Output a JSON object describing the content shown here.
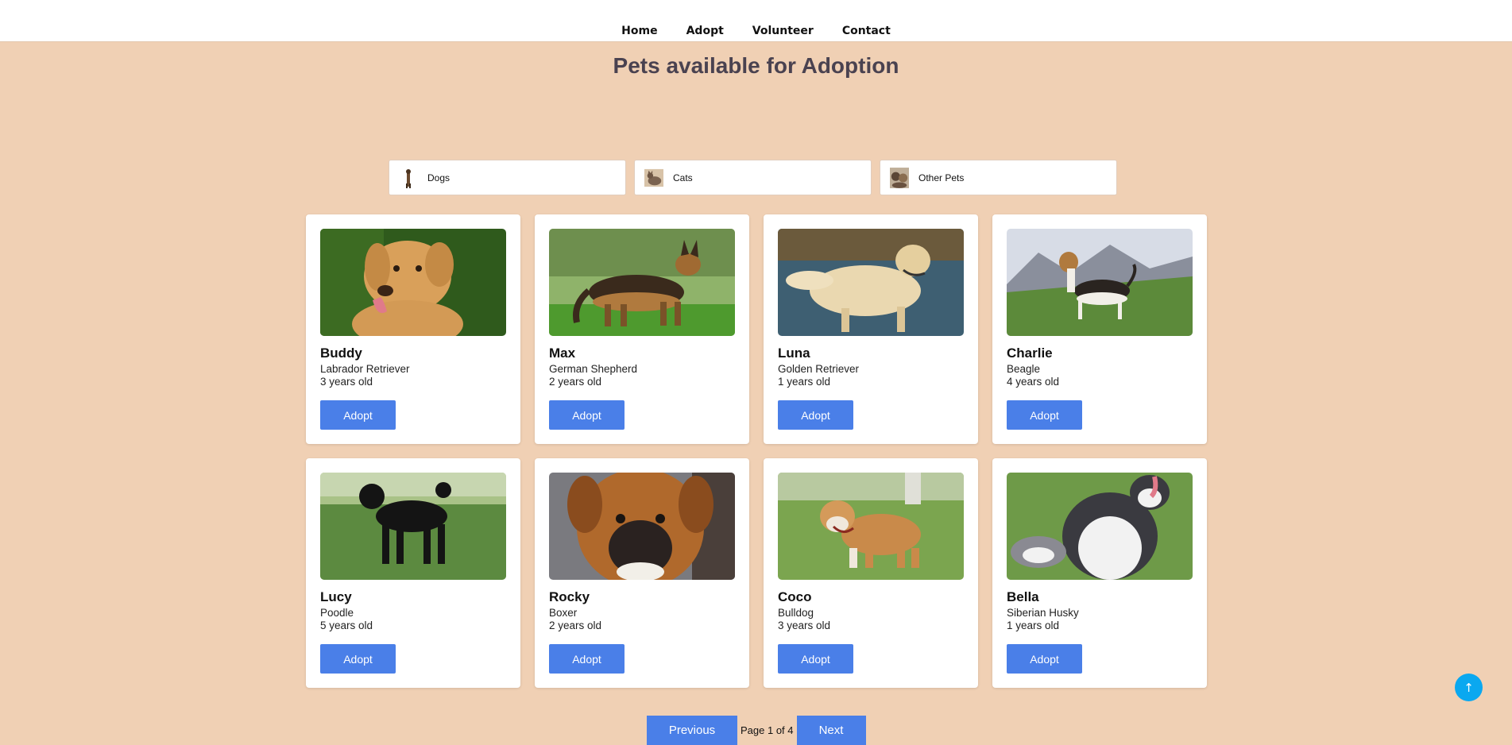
{
  "nav": {
    "home": "Home",
    "adopt": "Adopt",
    "volunteer": "Volunteer",
    "contact": "Contact"
  },
  "page_title": "Pets available for Adoption",
  "categories": [
    {
      "label": "Dogs",
      "icon": "dog-thumbnail"
    },
    {
      "label": "Cats",
      "icon": "cat-thumbnail"
    },
    {
      "label": "Other Pets",
      "icon": "other-pets-thumbnail"
    }
  ],
  "pets": [
    {
      "name": "Buddy",
      "breed": "Labrador Retriever",
      "age": "3 years old",
      "button": "Adopt"
    },
    {
      "name": "Max",
      "breed": "German Shepherd",
      "age": "2 years old",
      "button": "Adopt"
    },
    {
      "name": "Luna",
      "breed": "Golden Retriever",
      "age": "1 years old",
      "button": "Adopt"
    },
    {
      "name": "Charlie",
      "breed": "Beagle",
      "age": "4 years old",
      "button": "Adopt"
    },
    {
      "name": "Lucy",
      "breed": "Poodle",
      "age": "5 years old",
      "button": "Adopt"
    },
    {
      "name": "Rocky",
      "breed": "Boxer",
      "age": "2 years old",
      "button": "Adopt"
    },
    {
      "name": "Coco",
      "breed": "Bulldog",
      "age": "3 years old",
      "button": "Adopt"
    },
    {
      "name": "Bella",
      "breed": "Siberian Husky",
      "age": "1 years old",
      "button": "Adopt"
    }
  ],
  "pagination": {
    "previous": "Previous",
    "page_info": "Page 1 of 4",
    "next": "Next"
  },
  "scroll_top": {
    "glyph": "↑"
  },
  "colors": {
    "background": "#f0d0b4",
    "button": "#4a7fe8",
    "scroll_top": "#0aa8f0"
  }
}
